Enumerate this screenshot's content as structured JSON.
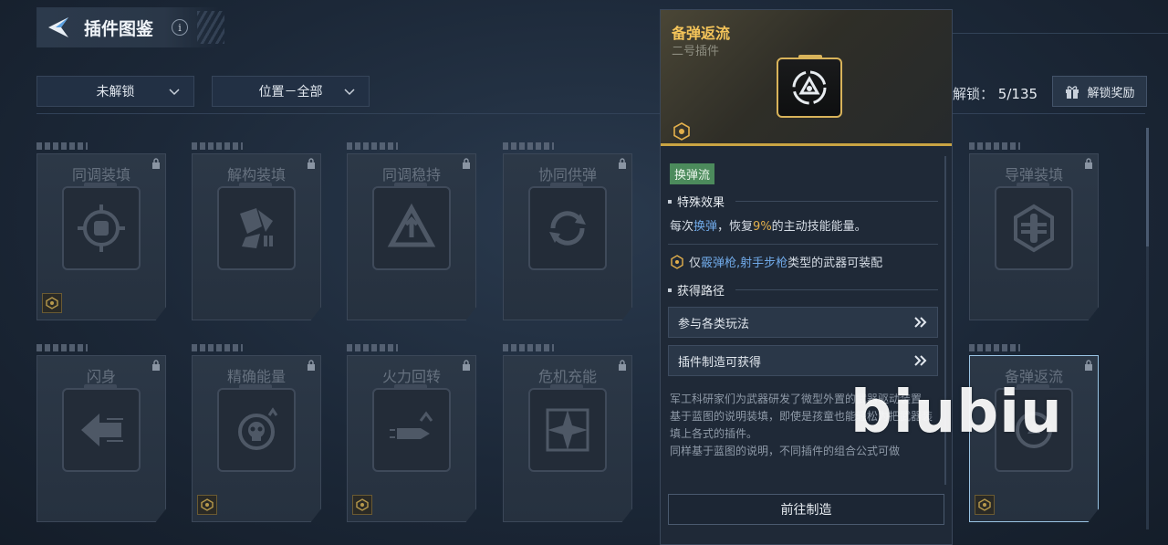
{
  "header": {
    "title": "插件图鉴",
    "info_label": "i"
  },
  "filters": {
    "status": "未解锁",
    "position": "位置－全部"
  },
  "unlock": {
    "label": "解锁：",
    "count": "5/135",
    "reward_button": "解锁奖励"
  },
  "cards": [
    {
      "name": "同调装填",
      "icon": "fist-crosshair-icon"
    },
    {
      "name": "解构装填",
      "icon": "shatter-icon"
    },
    {
      "name": "同调稳持",
      "icon": "triangle-arrows-icon"
    },
    {
      "name": "协同供弹",
      "icon": "cycle-ammo-icon"
    },
    {
      "name": "导弹装填",
      "icon": "missile-rack-icon"
    },
    {
      "name": "闪身",
      "icon": "dash-arrow-icon"
    },
    {
      "name": "精确能量",
      "icon": "skull-target-icon"
    },
    {
      "name": "火力回转",
      "icon": "bullet-arrow-icon"
    },
    {
      "name": "危机充能",
      "icon": "star-burst-icon"
    },
    {
      "name": "备弹返流",
      "icon": "reload-cycle-icon"
    }
  ],
  "detail": {
    "name": "备弹返流",
    "subtitle": "二号插件",
    "tag": "换弹流",
    "effect_heading": "特殊效果",
    "effect": {
      "p1": "每次",
      "hl1": "换弹",
      "p2": "，恢复",
      "hl2": "9%",
      "p3": "的主动技能能量。"
    },
    "weapon": {
      "p1": "仅",
      "hl": "霰弹枪,射手步枪",
      "p2": "类型的武器可装配"
    },
    "route_heading": "获得路径",
    "routes": [
      "参与各类玩法",
      "插件制造可获得"
    ],
    "description": [
      "军工科研家们为武器研发了微型外置的武器驱动装置。",
      "基于蓝图的说明装填，即使是孩童也能轻松为把武器装填上各式的插件。",
      "同样基于蓝图的说明，不同插件的组合公式可做"
    ],
    "go_button": "前往制造"
  },
  "watermark": "biubiu",
  "colors": {
    "gold": "#f4c45a",
    "tag_green": "#4c8b5c",
    "highlight_blue": "#6fa8e6"
  }
}
